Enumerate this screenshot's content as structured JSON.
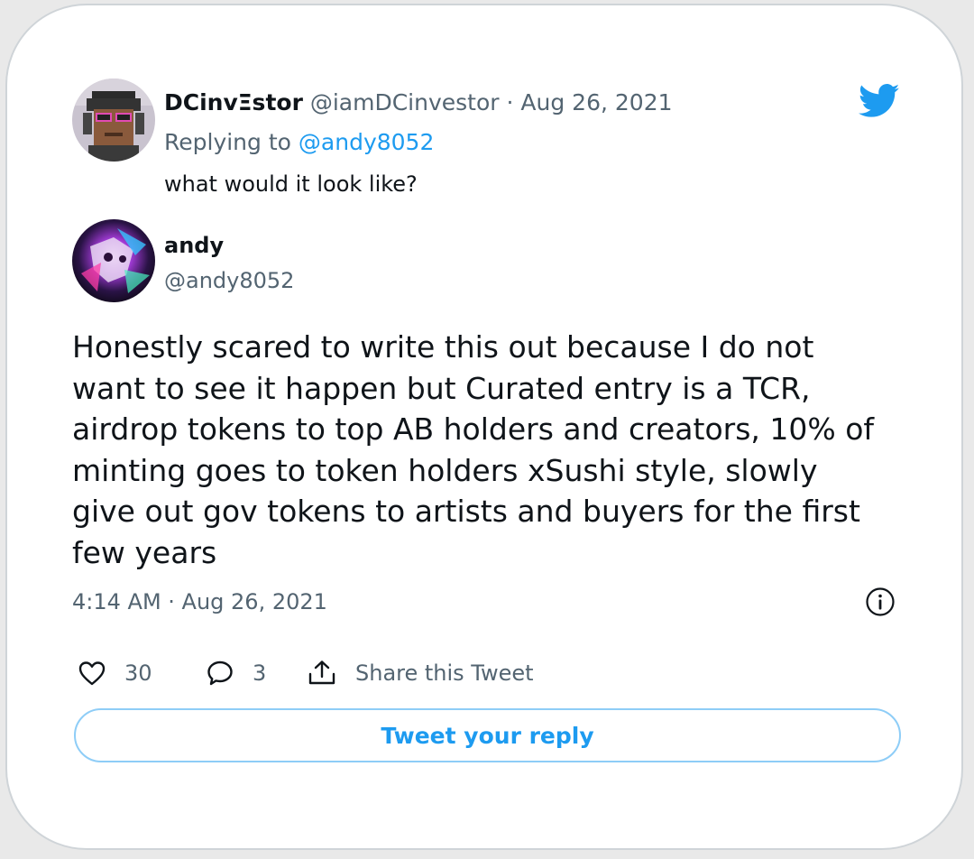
{
  "colors": {
    "accent": "#1d9bf0",
    "text": "#0f1419",
    "muted": "#536471",
    "button_border": "#8ecdf7"
  },
  "parent_tweet": {
    "display_name": "DCinvΞstor",
    "handle": "@iamDCinvestor",
    "separator": "·",
    "date": "Aug 26, 2021",
    "replying_to_label": "Replying to",
    "replying_to_handle": "@andy8052",
    "text": "what would it look like?",
    "avatar_icon": "pixel-avatar-icon"
  },
  "tweet": {
    "display_name": "andy",
    "handle": "@andy8052",
    "avatar_icon": "abstract-avatar-icon",
    "text": "Honestly scared to write this out because I do not\nwant to see it happen but Curated entry is a TCR,\nairdrop tokens to top AB holders and creators, 10% of\nminting goes to token holders xSushi style, slowly\ngive out gov tokens to artists and buyers for the first\nfew years",
    "timestamp": "4:14 AM · Aug 26, 2021",
    "info_icon": "info-icon",
    "brand_icon": "twitter-bird-icon"
  },
  "actions": {
    "like_count": "30",
    "like_icon": "heart-icon",
    "reply_count": "3",
    "reply_icon": "comment-bubble-icon",
    "share_label": "Share this Tweet",
    "share_icon": "share-upload-icon"
  },
  "reply_button": {
    "label": "Tweet your reply"
  }
}
